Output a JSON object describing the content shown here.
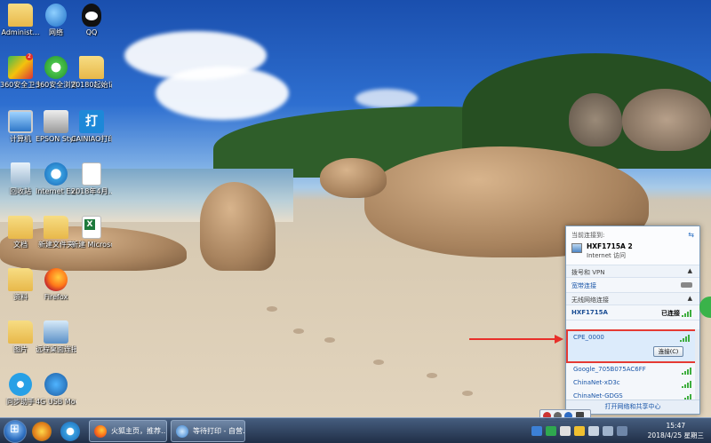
{
  "desktop": {
    "icons": [
      {
        "label": "Administ…",
        "icon": "user-folder-icon"
      },
      {
        "label": "网络",
        "icon": "network-icon"
      },
      {
        "label": "QQ",
        "icon": "qq-icon"
      },
      {
        "label": "360安全卫士",
        "icon": "security-360-icon",
        "badge": "2"
      },
      {
        "label": "360安全浏览器",
        "icon": "browser-360-icon"
      },
      {
        "label": "20180起始记录",
        "icon": "folder-icon"
      },
      {
        "label": "计算机",
        "icon": "computer-icon"
      },
      {
        "label": "EPSON Stylu…",
        "icon": "printer-icon"
      },
      {
        "label": "CAINIAO打印组件",
        "icon": "cainiao-icon"
      },
      {
        "label": "回收站",
        "icon": "recycle-bin-icon"
      },
      {
        "label": "Internet Explorer",
        "icon": "ie-icon"
      },
      {
        "label": "2018年4月…",
        "icon": "document-icon"
      },
      {
        "label": "文档",
        "icon": "folder-icon"
      },
      {
        "label": "新建文件夹",
        "icon": "folder-icon"
      },
      {
        "label": "新建 Microsof…",
        "icon": "excel-icon"
      },
      {
        "label": "资料",
        "icon": "folder-icon"
      },
      {
        "label": "Firefox",
        "icon": "firefox-icon"
      },
      {
        "label": "图片",
        "icon": "folder-icon"
      },
      {
        "label": "远程桌面连接",
        "icon": "remote-desktop-icon"
      },
      {
        "label": "同步助手",
        "icon": "sync-icon"
      },
      {
        "label": "4G USB Modem",
        "icon": "modem-icon"
      }
    ]
  },
  "flyout": {
    "current_header": "当前连接到:",
    "current_network": "HXF1715A  2",
    "current_status": "Internet 访问",
    "vpn_header": "拨号和 VPN",
    "broadband": "宽带连接",
    "wireless_header": "无线网络连接",
    "connected_network": "HXF1715A",
    "connected_label": "已连接",
    "selected_network": "CPE_0000",
    "connect_button": "连接(C)",
    "networks": [
      "Google_705B075AC6FF",
      "ChinaNet-xD3c",
      "ChinaNet-GDGS"
    ],
    "footer_link": "打开网络和共享中心"
  },
  "taskbar": {
    "windows": [
      {
        "label": "火狐主页，推荐…",
        "icon": "firefox-icon"
      },
      {
        "label": "等待打印 - 自营…",
        "icon": "browser-icon"
      }
    ],
    "clock_time": "15:47",
    "clock_date": "2018/4/25 星期三"
  },
  "colors": {
    "annotation_red": "#e8302a",
    "taskbar": "#1e3352",
    "link_blue": "#1a56a8"
  }
}
